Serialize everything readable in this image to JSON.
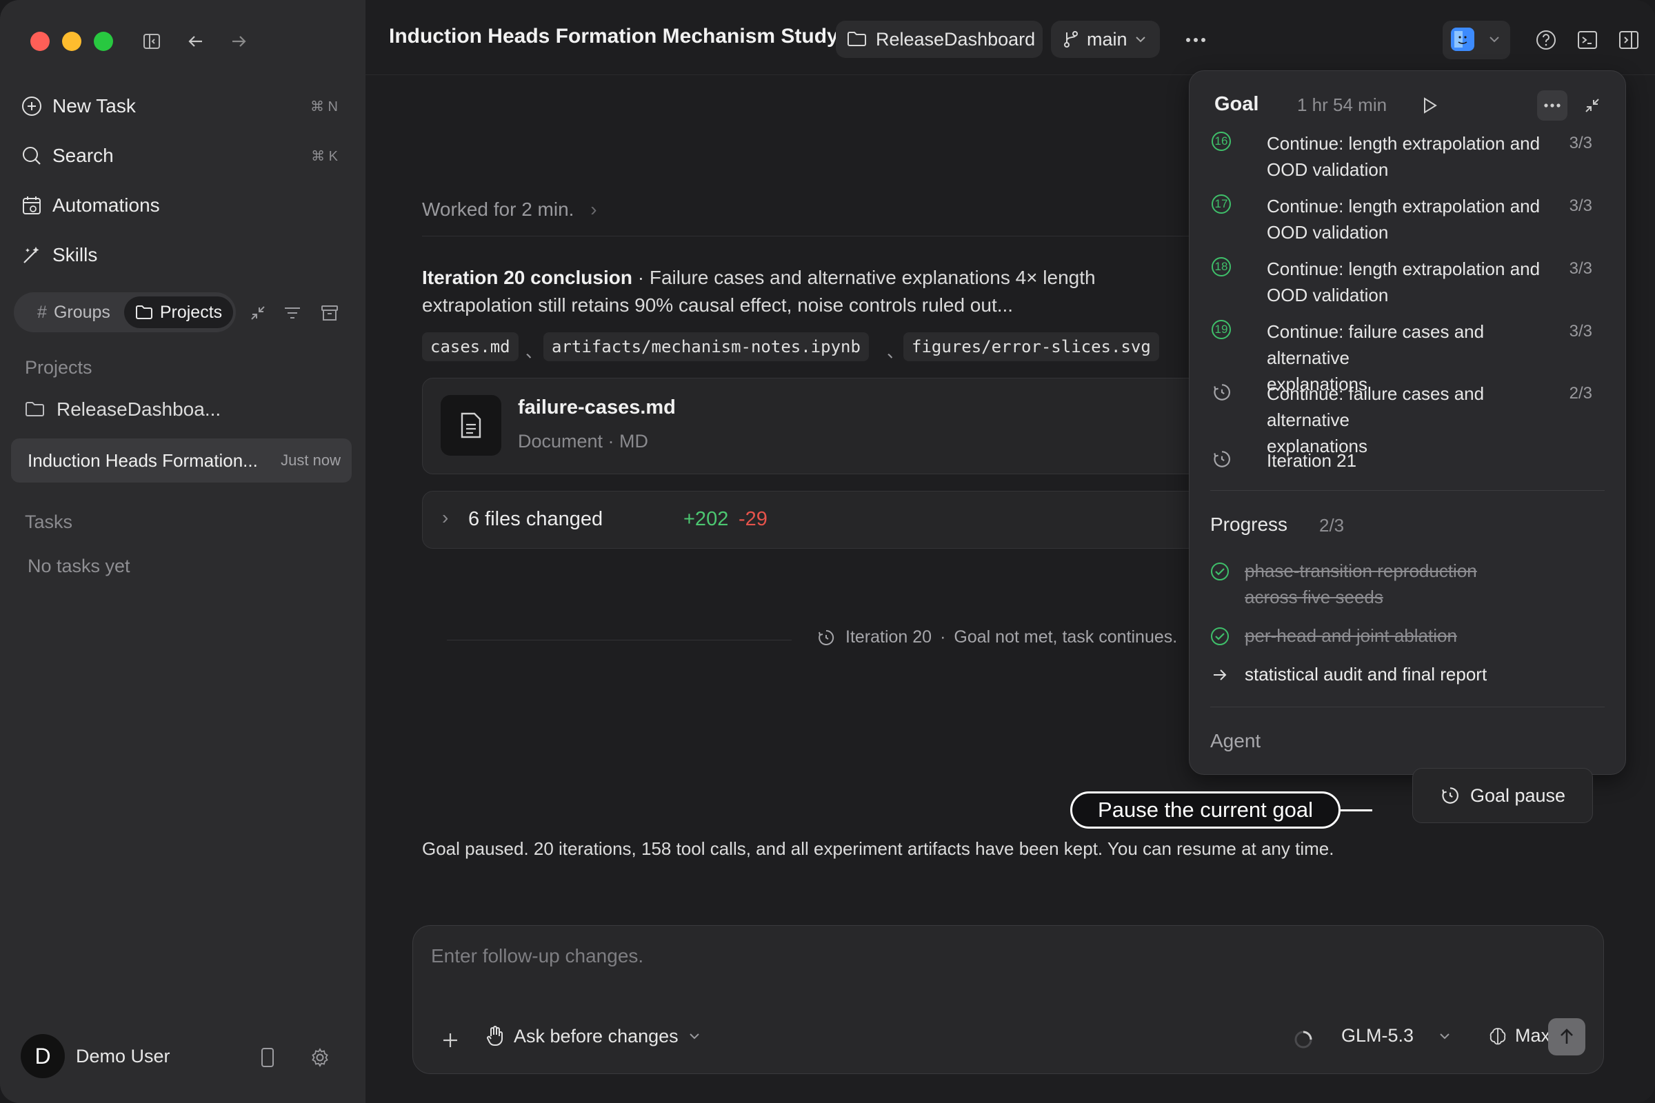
{
  "window": {
    "title": "Induction Heads Formation Mechanism Study",
    "project_chip": "ReleaseDashboard",
    "branch_chip": "main"
  },
  "sidebar": {
    "nav": [
      {
        "label": "New Task",
        "shortcut": "⌘ N",
        "icon": "plus-circle-icon"
      },
      {
        "label": "Search",
        "shortcut": "⌘ K",
        "icon": "search-icon"
      },
      {
        "label": "Automations",
        "shortcut": "",
        "icon": "calendar-icon"
      },
      {
        "label": "Skills",
        "shortcut": "",
        "icon": "magic-wand-icon"
      }
    ],
    "segments": {
      "groups": "Groups",
      "projects": "Projects",
      "active": "projects"
    },
    "projects_heading": "Projects",
    "project_item": "ReleaseDashboa...",
    "active_task": {
      "label": "Induction Heads Formation...",
      "time": "Just now"
    },
    "tasks_heading": "Tasks",
    "tasks_empty": "No tasks yet",
    "user": {
      "initial": "D",
      "name": "Demo User"
    }
  },
  "main": {
    "worked_for": "Worked for 2 min.",
    "conclusion_title": "Iteration 20 conclusion",
    "conclusion_sep": " · ",
    "conclusion_line1": "Failure cases and alternative explanations 4× length",
    "conclusion_line2": "extrapolation still retains 90% causal effect, noise controls ruled out...",
    "files": [
      "cases.md",
      "artifacts/mechanism-notes.ipynb",
      "figures/error-slices.svg"
    ],
    "file_sep": "、",
    "doc_card": {
      "name": "failure-cases.md",
      "meta": "Document · MD"
    },
    "changes": {
      "label": "6 files changed",
      "added": "+202",
      "removed": "-29"
    },
    "iteration_marker": {
      "label": "Iteration 20",
      "dot": "·",
      "status": "Goal not met, task continues."
    },
    "goal_pause_button": "Goal pause",
    "callout": "Pause the current goal",
    "paused_message": "Goal paused. 20 iterations, 158 tool calls, and all experiment artifacts have been kept. You can resume at any time."
  },
  "goal_panel": {
    "title": "Goal",
    "elapsed": "1 hr 54 min",
    "items": [
      {
        "num": "16",
        "text_line1": "Continue: length extrapolation and",
        "text_line2": "OOD validation",
        "count": "3/3",
        "state": "done"
      },
      {
        "num": "17",
        "text_line1": "Continue: length extrapolation and",
        "text_line2": "OOD validation",
        "count": "3/3",
        "state": "done"
      },
      {
        "num": "18",
        "text_line1": "Continue: length extrapolation and",
        "text_line2": "OOD validation",
        "count": "3/3",
        "state": "done"
      },
      {
        "num": "19",
        "text_line1": "Continue: failure cases and alternative",
        "text_line2": "explanations",
        "count": "3/3",
        "state": "done"
      },
      {
        "num": "",
        "text_line1": "Continue: failure cases and alternative",
        "text_line2": "explanations",
        "count": "2/3",
        "state": "running"
      },
      {
        "num": "",
        "text_line1": "Iteration 21",
        "text_line2": "",
        "count": "",
        "state": "running"
      }
    ],
    "progress_title": "Progress",
    "progress_count": "2/3",
    "progress_items": [
      {
        "line1": "phase-transition reproduction",
        "line2": "across five seeds",
        "state": "done"
      },
      {
        "line1": "per-head and joint ablation",
        "line2": "",
        "state": "done"
      },
      {
        "line1": "statistical audit and final report",
        "line2": "",
        "state": "current"
      }
    ],
    "agent_title": "Agent"
  },
  "composer": {
    "placeholder": "Enter follow-up changes.",
    "mode": "Ask before changes",
    "model": "GLM-5.3",
    "effort": "Max"
  },
  "colors": {
    "accent_green": "#3fbf6a",
    "removed_red": "#e5534b",
    "added_green": "#4cc771"
  }
}
